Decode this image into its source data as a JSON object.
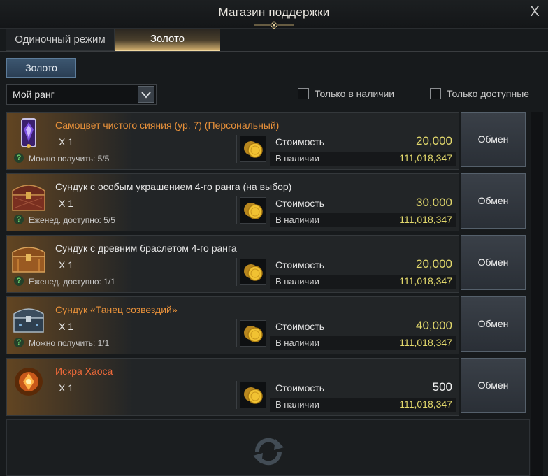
{
  "window": {
    "title": "Магазин поддержки",
    "close_label": "X"
  },
  "tabs": [
    {
      "label": "Одиночный режим",
      "active": false
    },
    {
      "label": "Золото",
      "active": true
    }
  ],
  "subtab": {
    "label": "Золото"
  },
  "filter": {
    "rank_selected": "Мой ранг",
    "only_in_stock": "Только в наличии",
    "only_available": "Только доступные"
  },
  "labels": {
    "cost": "Стоимость",
    "stock": "В наличии",
    "exchange": "Обмен"
  },
  "colors": {
    "accent_gold": "#e3d96c",
    "name_orange": "#e8913a",
    "name_white": "#e6e6e6",
    "name_red": "#f06a3a",
    "limit_green": "#69d36b"
  },
  "items": [
    {
      "name": "Самоцвет чистого сияния (ур. 7) (Персональный)",
      "qty": "X 1",
      "limit": "Можно получить: 5/5",
      "cost": "20,000",
      "stock": "111,018,347",
      "icon": "purple-gem-icon"
    },
    {
      "name": "Сундук с особым украшением 4-го ранга (на выбор)",
      "qty": "X 1",
      "limit": "Еженед. доступно: 5/5",
      "cost": "30,000",
      "stock": "111,018,347",
      "icon": "red-chest-icon"
    },
    {
      "name": "Сундук с древним браслетом 4-го ранга",
      "qty": "X 1",
      "limit": "Еженед. доступно: 1/1",
      "cost": "20,000",
      "stock": "111,018,347",
      "icon": "bracelet-chest-icon"
    },
    {
      "name": "Сундук «Танец созвездий»",
      "qty": "X 1",
      "limit": "Можно получить: 1/1",
      "cost": "40,000",
      "stock": "111,018,347",
      "icon": "blue-chest-icon"
    },
    {
      "name": "Искра Хаоса",
      "qty": "X 1",
      "limit": "",
      "cost": "500",
      "stock": "111,018,347",
      "icon": "chaos-spark-icon"
    }
  ]
}
